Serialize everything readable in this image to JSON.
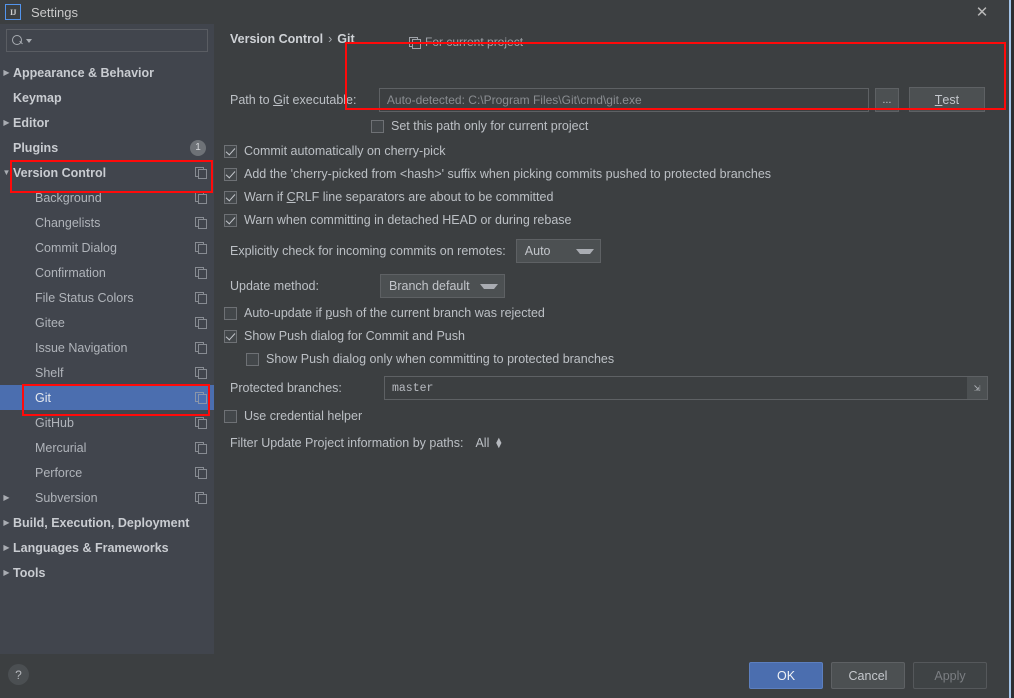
{
  "window": {
    "title": "Settings",
    "logo_text": "IJ",
    "close_icon": "close-icon"
  },
  "sidebar": {
    "search": {
      "value": "",
      "placeholder": ""
    },
    "items": [
      {
        "label": "Appearance & Behavior",
        "arrow": "▶",
        "bold": true,
        "child": false,
        "icon": "",
        "selected": false
      },
      {
        "label": "Keymap",
        "arrow": "",
        "bold": true,
        "child": false,
        "icon": "",
        "selected": false
      },
      {
        "label": "Editor",
        "arrow": "▶",
        "bold": true,
        "child": false,
        "icon": "",
        "selected": false
      },
      {
        "label": "Plugins",
        "arrow": "",
        "bold": true,
        "child": false,
        "icon": "badge",
        "badge": "1",
        "selected": false
      },
      {
        "label": "Version Control",
        "arrow": "▼",
        "bold": true,
        "child": false,
        "icon": "copy",
        "selected": false
      },
      {
        "label": "Background",
        "arrow": "",
        "bold": false,
        "child": true,
        "icon": "copy",
        "selected": false
      },
      {
        "label": "Changelists",
        "arrow": "",
        "bold": false,
        "child": true,
        "icon": "copy",
        "selected": false
      },
      {
        "label": "Commit Dialog",
        "arrow": "",
        "bold": false,
        "child": true,
        "icon": "copy",
        "selected": false
      },
      {
        "label": "Confirmation",
        "arrow": "",
        "bold": false,
        "child": true,
        "icon": "copy",
        "selected": false
      },
      {
        "label": "File Status Colors",
        "arrow": "",
        "bold": false,
        "child": true,
        "icon": "copy",
        "selected": false
      },
      {
        "label": "Gitee",
        "arrow": "",
        "bold": false,
        "child": true,
        "icon": "copy",
        "selected": false
      },
      {
        "label": "Issue Navigation",
        "arrow": "",
        "bold": false,
        "child": true,
        "icon": "copy",
        "selected": false
      },
      {
        "label": "Shelf",
        "arrow": "",
        "bold": false,
        "child": true,
        "icon": "copy",
        "selected": false
      },
      {
        "label": "Git",
        "arrow": "",
        "bold": false,
        "child": true,
        "icon": "copy",
        "selected": true
      },
      {
        "label": "GitHub",
        "arrow": "",
        "bold": false,
        "child": true,
        "icon": "copy",
        "selected": false
      },
      {
        "label": "Mercurial",
        "arrow": "",
        "bold": false,
        "child": true,
        "icon": "copy",
        "selected": false
      },
      {
        "label": "Perforce",
        "arrow": "",
        "bold": false,
        "child": true,
        "icon": "copy",
        "selected": false
      },
      {
        "label": "Subversion",
        "arrow": "▶",
        "bold": false,
        "child": true,
        "icon": "copy",
        "selected": false
      },
      {
        "label": "Build, Execution, Deployment",
        "arrow": "▶",
        "bold": true,
        "child": false,
        "icon": "",
        "selected": false
      },
      {
        "label": "Languages & Frameworks",
        "arrow": "▶",
        "bold": true,
        "child": false,
        "icon": "",
        "selected": false
      },
      {
        "label": "Tools",
        "arrow": "▶",
        "bold": true,
        "child": false,
        "icon": "",
        "selected": false
      }
    ]
  },
  "main": {
    "breadcrumb": {
      "parent": "Version Control",
      "separator": "›",
      "current": "Git"
    },
    "for_current_project": "For current project",
    "path_label_pre": "Path to ",
    "path_label_key": "G",
    "path_label_post": "it executable:",
    "path_field": {
      "value": "",
      "placeholder": "Auto-detected: C:\\Program Files\\Git\\cmd\\git.exe"
    },
    "browse_button": "...",
    "test_button": "Test",
    "test_button_key": "T",
    "set_path_checkbox": {
      "label": "Set this path only for current project",
      "checked": false
    },
    "checkboxes_top": [
      {
        "label": "Commit automatically on cherry-pick",
        "checked": true
      },
      {
        "label": "Add the 'cherry-picked from <hash>' suffix when picking commits pushed to protected branches",
        "checked": true
      },
      {
        "label": "Warn if CRLF line separators are about to be committed",
        "checked": true
      },
      {
        "label": "Warn when committing in detached HEAD or during rebase",
        "checked": true
      }
    ],
    "incoming_commits": {
      "label": "Explicitly check for incoming commits on remotes:",
      "value": "Auto"
    },
    "update_method": {
      "label": "Update method:",
      "value": "Branch default"
    },
    "auto_update_checkbox": {
      "label": "Auto-update if push of the current branch was rejected",
      "checked": false
    },
    "show_push_checkbox": {
      "label": "Show Push dialog for Commit and Push",
      "checked": true
    },
    "show_push_protected_checkbox": {
      "label": "Show Push dialog only when committing to protected branches",
      "checked": false
    },
    "protected_branches": {
      "label": "Protected branches:",
      "value": "master",
      "expand_icon": "expand-icon"
    },
    "credential_helper_checkbox": {
      "label": "Use credential helper",
      "checked": false
    },
    "filter_paths": {
      "label": "Filter Update Project information by paths:",
      "value": "All"
    }
  },
  "footer": {
    "help": "?",
    "ok": "OK",
    "cancel": "Cancel",
    "apply": "Apply"
  },
  "colors": {
    "background": "#3C3F41",
    "sidebar": "#41454D",
    "selection": "#4B6EAF",
    "accent_button": "#4B6EAF",
    "annotation": "#FF0A0A",
    "text": "#BBBBBB",
    "window_border": "#A3C4E8"
  }
}
